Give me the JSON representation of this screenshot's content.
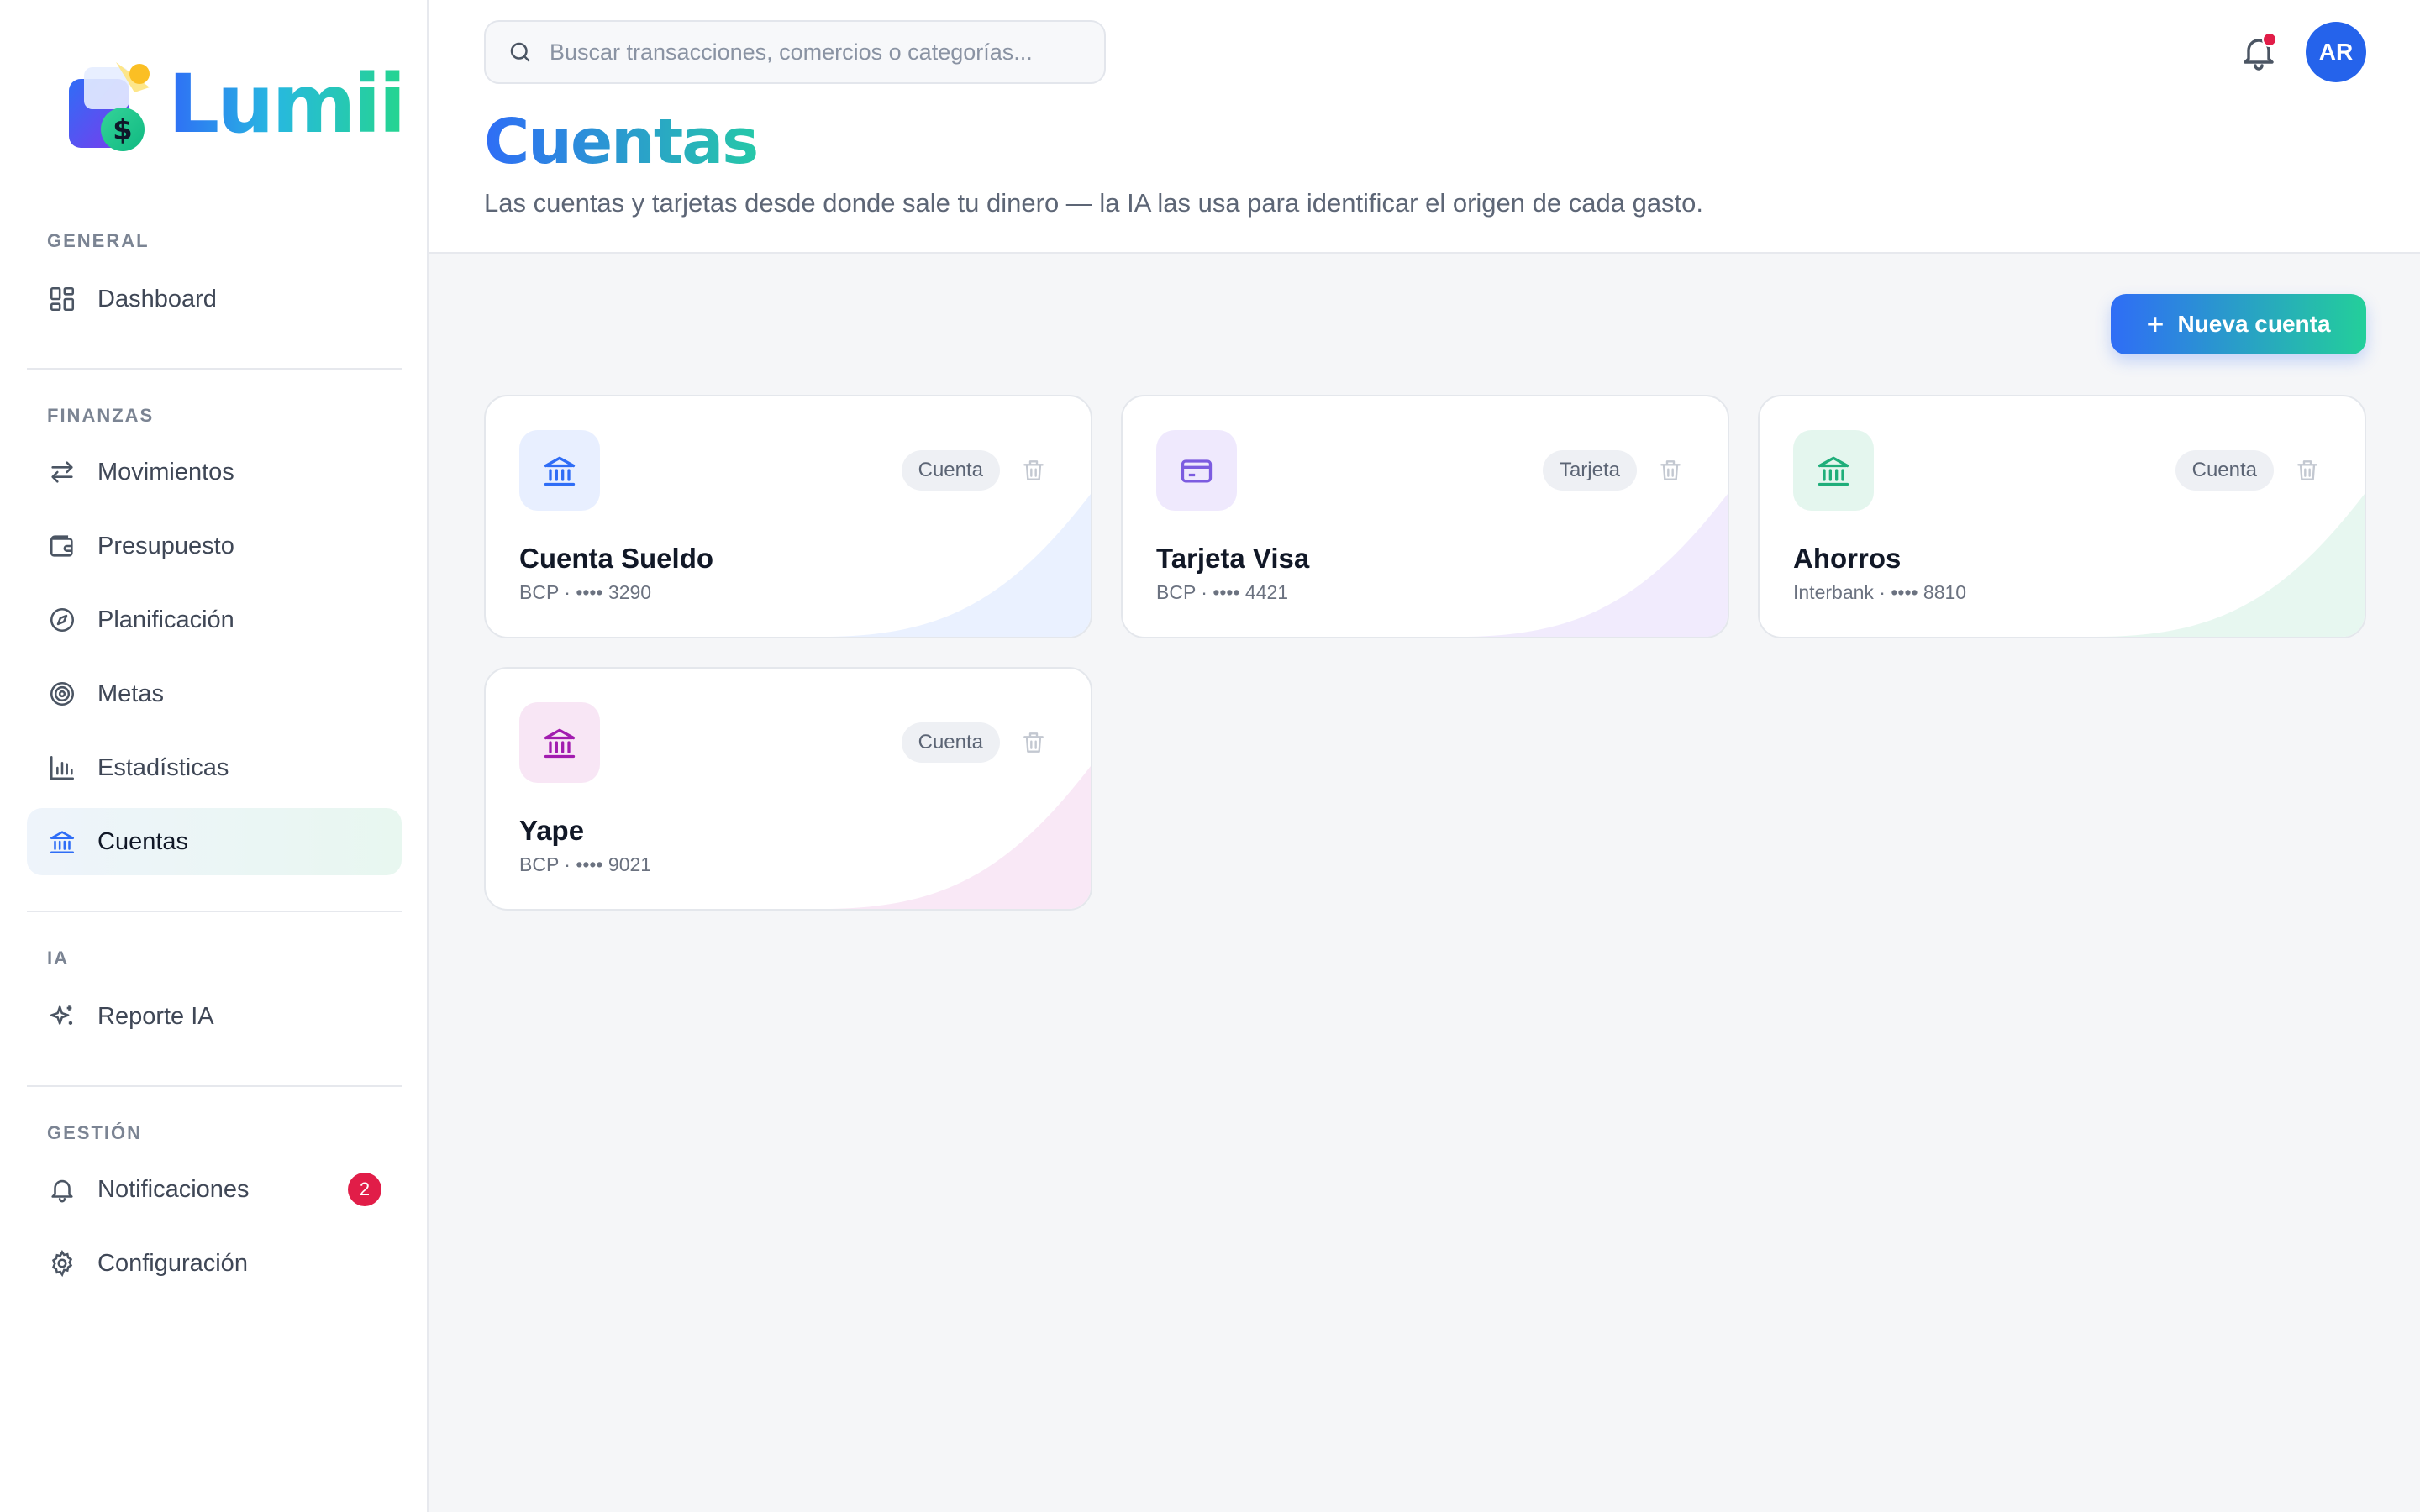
{
  "brand": {
    "name": "Lumii"
  },
  "sidebar": {
    "sections": [
      {
        "title": "GENERAL",
        "items": [
          {
            "label": "Dashboard",
            "icon": "dashboard-icon"
          }
        ]
      },
      {
        "title": "FINANZAS",
        "items": [
          {
            "label": "Movimientos",
            "icon": "transfer-icon"
          },
          {
            "label": "Presupuesto",
            "icon": "wallet-icon"
          },
          {
            "label": "Planificación",
            "icon": "compass-icon"
          },
          {
            "label": "Metas",
            "icon": "target-icon"
          },
          {
            "label": "Estadísticas",
            "icon": "bar-chart-icon"
          },
          {
            "label": "Cuentas",
            "icon": "bank-icon",
            "active": true
          }
        ]
      },
      {
        "title": "IA",
        "items": [
          {
            "label": "Reporte IA",
            "icon": "sparkles-icon"
          }
        ]
      },
      {
        "title": "GESTIÓN",
        "items": [
          {
            "label": "Notificaciones",
            "icon": "bell-icon",
            "badge": "2"
          },
          {
            "label": "Configuración",
            "icon": "gear-icon"
          }
        ]
      }
    ]
  },
  "header": {
    "search_placeholder": "Buscar transacciones, comercios o categorías...",
    "avatar_initials": "AR",
    "page_title": "Cuentas",
    "page_subtitle": "Las cuentas y tarjetas desde donde sale tu dinero — la IA las usa para identificar el origen de cada gasto."
  },
  "actions": {
    "new_account_label": "Nueva cuenta"
  },
  "accounts": [
    {
      "name": "Cuenta Sueldo",
      "type": "Cuenta",
      "detail": "BCP · •••• 3290",
      "icon": "bank-icon",
      "accent": "#2f6df6",
      "tint": "#e8efff"
    },
    {
      "name": "Tarjeta Visa",
      "type": "Tarjeta",
      "detail": "BCP · •••• 4421",
      "icon": "credit-card-icon",
      "accent": "#7c5ce0",
      "tint": "#efe9fd"
    },
    {
      "name": "Ahorros",
      "type": "Cuenta",
      "detail": "Interbank · •••• 8810",
      "icon": "bank-icon",
      "accent": "#1fae7a",
      "tint": "#e4f6ee"
    },
    {
      "name": "Yape",
      "type": "Cuenta",
      "detail": "BCP · •••• 9021",
      "icon": "bank-icon",
      "accent": "#a21caf",
      "tint": "#f8e6f5"
    }
  ]
}
